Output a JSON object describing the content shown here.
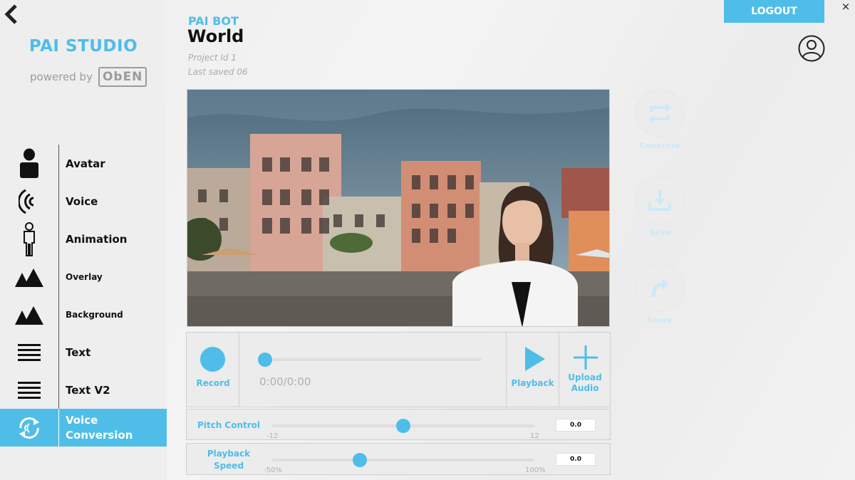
{
  "app": {
    "brand": "PAI STUDIO",
    "powered_by": "powered by",
    "powered_logo": "ObEN"
  },
  "header": {
    "subtitle": "PAI BOT",
    "title": "World",
    "project_id": "Project Id 1",
    "last_saved": "Last saved 06",
    "logout_label": "LOGOUT",
    "close_glyph": "×"
  },
  "sidebar": {
    "active_index": 7,
    "items": [
      {
        "label": "Avatar",
        "icon": "avatar-icon"
      },
      {
        "label": "Voice",
        "icon": "voice-icon"
      },
      {
        "label": "Animation",
        "icon": "animation-icon"
      },
      {
        "label": "Overlay",
        "icon": "mountains-icon"
      },
      {
        "label": "Background",
        "icon": "mountains-icon"
      },
      {
        "label": "Text",
        "icon": "lines-icon"
      },
      {
        "label": "Text V2",
        "icon": "lines-icon"
      },
      {
        "label": "Voice\nConversion",
        "icon": "voice-conversion-icon"
      }
    ]
  },
  "actions": {
    "generate": "Generate",
    "save": "Save",
    "share": "Share"
  },
  "recorder": {
    "record_label": "Record",
    "time": "0:00/0:00",
    "progress": 0,
    "playback_label": "Playback",
    "upload_label_1": "Upload",
    "upload_label_2": "Audio"
  },
  "pitch": {
    "label": "Pitch Control",
    "min": "-12",
    "max": "12",
    "value": "0.0",
    "fraction": 0.5
  },
  "speed": {
    "label_1": "Playback",
    "label_2": "Speed",
    "min": "-50%",
    "max": "100%",
    "value": "0.0",
    "fraction": 0.333
  },
  "colors": {
    "accent": "#4ebee9",
    "sidebar_bg": "#eeeeee",
    "panel_bg": "#ececec"
  }
}
